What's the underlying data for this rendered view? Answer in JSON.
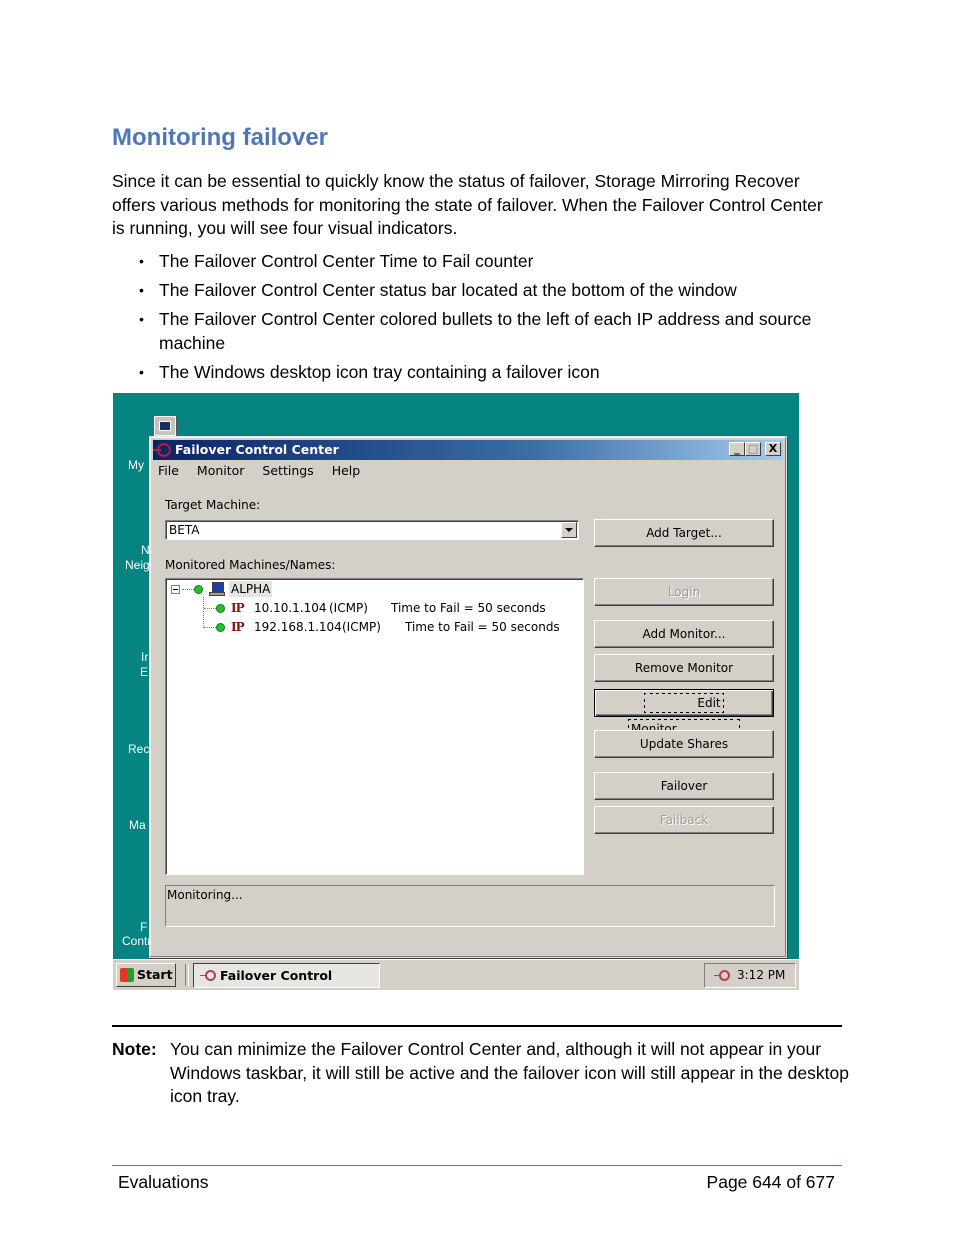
{
  "heading": "Monitoring failover",
  "intro": "Since it can be essential to quickly know the status of failover, Storage Mirroring Recover offers various methods for monitoring the state of failover. When the Failover Control Center is running, you will see four visual indicators.",
  "bullets": [
    "The Failover Control Center Time to Fail counter",
    "The Failover Control Center status bar located at the bottom of the window",
    "The Failover Control Center colored bullets to the left of each IP address and source machine",
    "The Windows desktop icon tray containing a failover icon"
  ],
  "screenshot": {
    "desktop_labels": [
      "My",
      "N",
      "Neig",
      "Ir",
      "E",
      "Rec",
      "Ma",
      "F",
      "Control Center"
    ],
    "window": {
      "title": "Failover Control Center",
      "controls": {
        "minimize": "_",
        "maximize": "□",
        "close": "X"
      },
      "menu": [
        "File",
        "Monitor",
        "Settings",
        "Help"
      ],
      "target_label": "Target Machine:",
      "target_value": "BETA",
      "monitored_label": "Monitored Machines/Names:",
      "tree": {
        "machine": {
          "name": "ALPHA",
          "status_color": "#22c22a"
        },
        "monitors": [
          {
            "icon": "IP",
            "address": "10.10.1.104",
            "protocol": "(ICMP)",
            "time_to_fail": "Time to Fail = 50 seconds",
            "status_color": "#22c22a"
          },
          {
            "icon": "IP",
            "address": "192.168.1.104",
            "protocol": "(ICMP)",
            "time_to_fail": "Time to Fail = 50 seconds",
            "status_color": "#22c22a"
          }
        ]
      },
      "buttons": {
        "add_target": "Add Target...",
        "login": "Login",
        "add_monitor": "Add Monitor...",
        "remove_monitor": "Remove Monitor",
        "edit_monitor": "Edit Monitor...",
        "update_shares": "Update Shares",
        "failover": "Failover",
        "failback": "Failback"
      },
      "status_text": "Monitoring..."
    },
    "taskbar": {
      "start_label": "Start",
      "task_label": "Failover Control Center",
      "clock": "3:12 PM"
    }
  },
  "note": {
    "label": "Note:",
    "text": "You can minimize the Failover Control Center and, although it will not appear in your Windows taskbar, it will still be active and the failover icon will still appear in the desktop icon tray."
  },
  "footer": {
    "section": "Evaluations",
    "page": "Page 644 of 677"
  }
}
